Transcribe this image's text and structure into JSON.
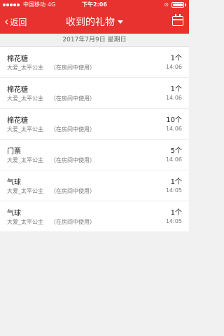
{
  "status": {
    "carrier": "中国移动",
    "network": "4G",
    "time": "下午2:06"
  },
  "nav": {
    "back_label": "返回",
    "title": "收到的礼物"
  },
  "date_header": "2017年7月9日 星期日",
  "items": [
    {
      "name": "棉花糖",
      "sender": "大爱_太平公主",
      "note": "（在房间中使用）",
      "qty": "1个",
      "time": "14:06"
    },
    {
      "name": "棉花糖",
      "sender": "大爱_太平公主",
      "note": "（在房间中使用）",
      "qty": "1个",
      "time": "14:06"
    },
    {
      "name": "棉花糖",
      "sender": "大爱_太平公主",
      "note": "（在房间中使用）",
      "qty": "10个",
      "time": "14:06"
    },
    {
      "name": "门票",
      "sender": "大爱_太平公主",
      "note": "（在房间中使用）",
      "qty": "5个",
      "time": "14:06"
    },
    {
      "name": "气球",
      "sender": "大爱_太平公主",
      "note": "（在房间中使用）",
      "qty": "1个",
      "time": "14:05"
    },
    {
      "name": "气球",
      "sender": "大爱_太平公主",
      "note": "（在房间中使用）",
      "qty": "1个",
      "time": "14:05"
    }
  ],
  "colors": {
    "header_red": "#e8322f",
    "background": "#f1f1f1"
  },
  "icons": {
    "back": "chevron-left-icon",
    "title_caret": "caret-down-icon",
    "calendar": "calendar-icon",
    "battery": "battery-icon",
    "signal": "signal-dots-icon",
    "lock": "rotation-lock-icon"
  }
}
